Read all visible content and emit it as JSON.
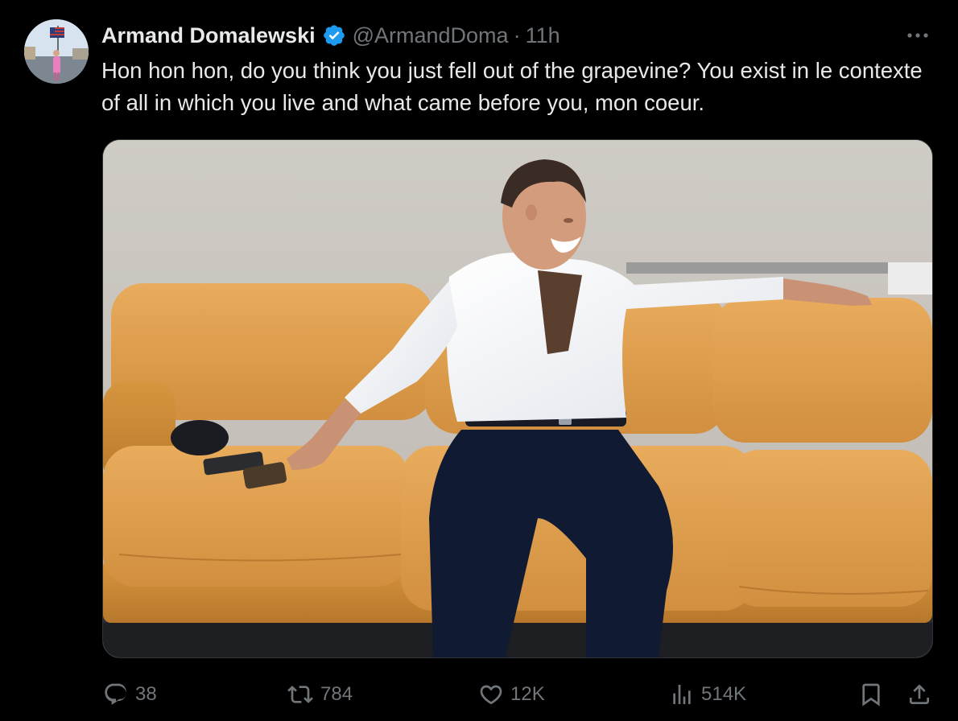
{
  "tweet": {
    "author": {
      "display_name": "Armand Domalewski",
      "handle": "@ArmandDoma",
      "verified": true
    },
    "separator": "·",
    "timestamp": "11h",
    "text": "Hon hon hon, do you think you just fell out of the grapevine? You exist in le contexte of all in which you live and what came before you, mon coeur.",
    "actions": {
      "replies": "38",
      "reposts": "784",
      "likes": "12K",
      "views": "514K"
    }
  },
  "icons": {
    "verified": "verified-badge-icon",
    "more": "more-horizontal-icon",
    "reply": "reply-icon",
    "repost": "repost-icon",
    "like": "heart-icon",
    "views": "analytics-icon",
    "bookmark": "bookmark-icon",
    "share": "share-icon"
  },
  "colors": {
    "background": "#000000",
    "primary_text": "#e7e9ea",
    "secondary_text": "#71767b",
    "verified_blue": "#1d9bf0",
    "border": "#2f3336"
  }
}
